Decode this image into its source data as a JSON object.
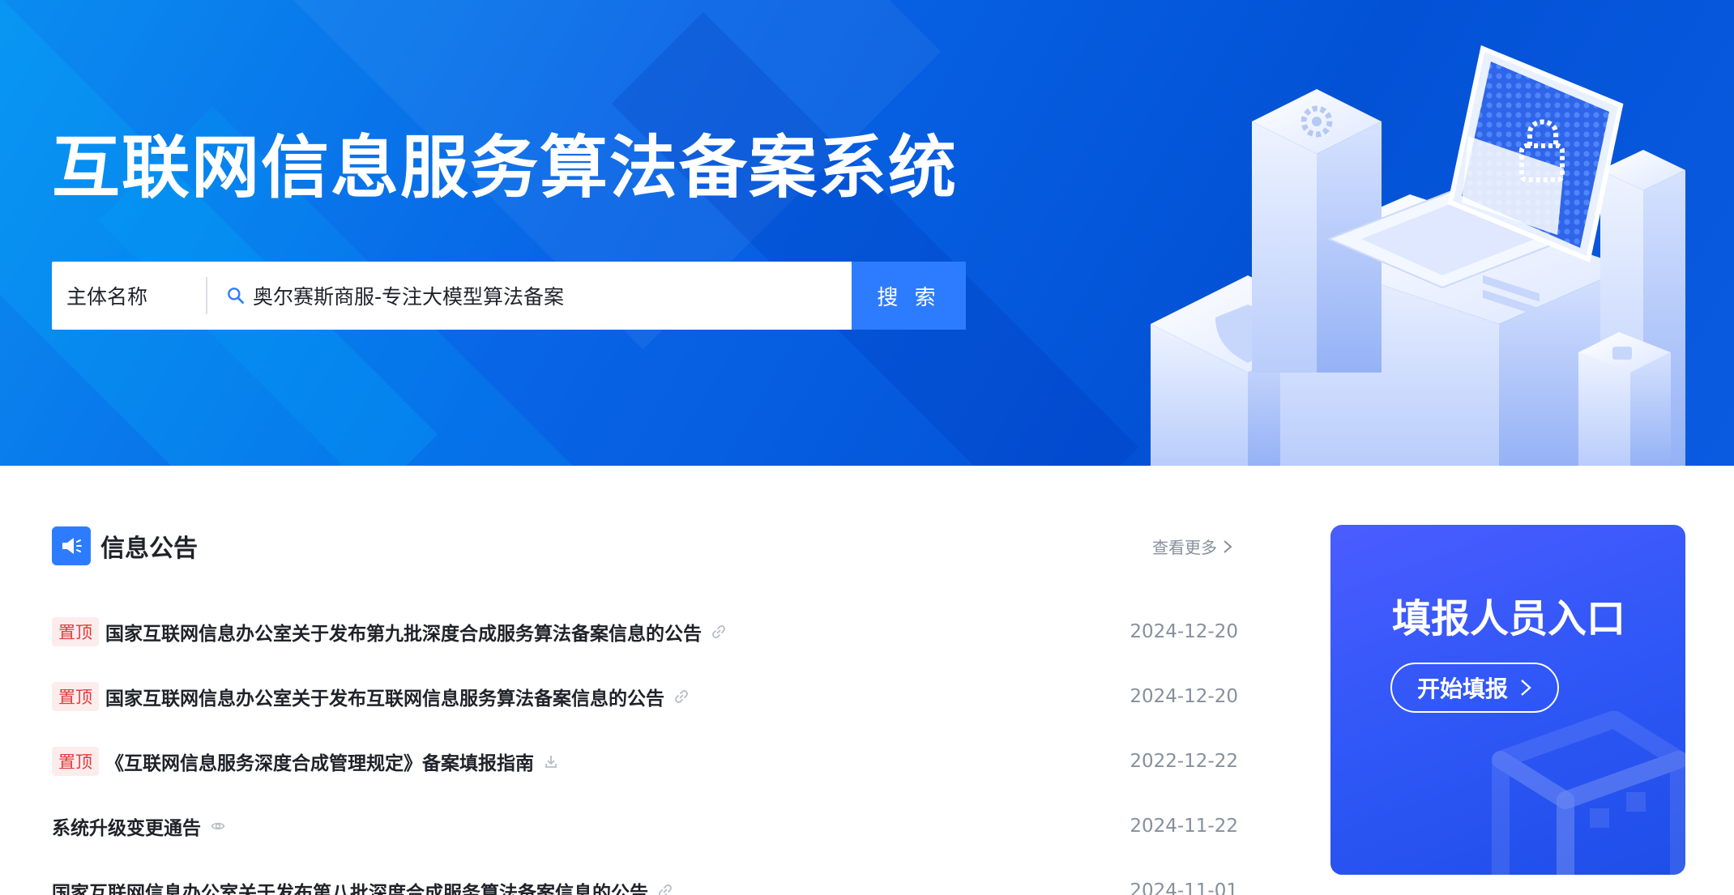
{
  "hero": {
    "title": "互联网信息服务算法备案系统",
    "search": {
      "type_label": "主体名称",
      "value": "奥尔赛斯商服-专注大模型算法备案",
      "button_label": "搜 索"
    }
  },
  "notices": {
    "title": "信息公告",
    "view_more": "查看更多",
    "items": [
      {
        "pinned": true,
        "badge": "置顶",
        "title": "国家互联网信息办公室关于发布第九批深度合成服务算法备案信息的公告",
        "icon": "link-icon",
        "date": "2024-12-20"
      },
      {
        "pinned": true,
        "badge": "置顶",
        "title": "国家互联网信息办公室关于发布互联网信息服务算法备案信息的公告",
        "icon": "link-icon",
        "date": "2024-12-20"
      },
      {
        "pinned": true,
        "badge": "置顶",
        "title": "《互联网信息服务深度合成管理规定》备案填报指南",
        "icon": "download-icon",
        "date": "2022-12-22"
      },
      {
        "pinned": false,
        "title": "系统升级变更通告",
        "icon": "eye-icon",
        "date": "2024-11-22"
      },
      {
        "pinned": false,
        "title": "国家互联网信息办公室关于发布第八批深度合成服务算法备案信息的公告",
        "icon": "link-icon",
        "date": "2024-11-01"
      }
    ]
  },
  "reporter": {
    "title": "填报人员入口",
    "button_label": "开始填报"
  },
  "colors": {
    "primary": "#2d7cff",
    "hero_blue": "#0352d6",
    "badge_text": "#e23b3b",
    "badge_bg": "#fdecec",
    "muted": "#86909c"
  }
}
